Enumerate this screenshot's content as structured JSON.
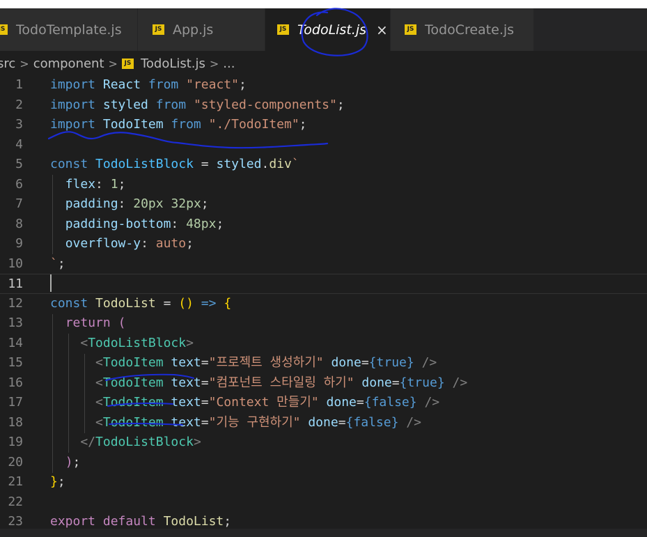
{
  "tabs": [
    {
      "label": "TodoTemplate.js",
      "icon": "JS",
      "active": false
    },
    {
      "label": "App.js",
      "icon": "JS",
      "active": false
    },
    {
      "label": "TodoList.js",
      "icon": "JS",
      "active": true,
      "close": "×"
    },
    {
      "label": "TodoCreate.js",
      "icon": "JS",
      "active": false
    }
  ],
  "breadcrumb": {
    "items": [
      "src",
      "component",
      "TodoList.js",
      "..."
    ],
    "separator": ">",
    "file_icon": "JS"
  },
  "editor": {
    "current_line": 11,
    "lines": [
      {
        "n": 1,
        "tokens": [
          [
            "kw",
            "import"
          ],
          [
            "p",
            " "
          ],
          [
            "var",
            "React"
          ],
          [
            "p",
            " "
          ],
          [
            "kw",
            "from"
          ],
          [
            "p",
            " "
          ],
          [
            "str",
            "\"react\""
          ],
          [
            "p",
            ";"
          ]
        ]
      },
      {
        "n": 2,
        "tokens": [
          [
            "kw",
            "import"
          ],
          [
            "p",
            " "
          ],
          [
            "var",
            "styled"
          ],
          [
            "p",
            " "
          ],
          [
            "kw",
            "from"
          ],
          [
            "p",
            " "
          ],
          [
            "str",
            "\"styled-components\""
          ],
          [
            "p",
            ";"
          ]
        ]
      },
      {
        "n": 3,
        "tokens": [
          [
            "kw",
            "import"
          ],
          [
            "p",
            " "
          ],
          [
            "var",
            "TodoItem"
          ],
          [
            "p",
            " "
          ],
          [
            "kw",
            "from"
          ],
          [
            "p",
            " "
          ],
          [
            "str",
            "\"./TodoItem\""
          ],
          [
            "p",
            ";"
          ]
        ]
      },
      {
        "n": 4,
        "tokens": []
      },
      {
        "n": 5,
        "tokens": [
          [
            "kw",
            "const"
          ],
          [
            "p",
            " "
          ],
          [
            "ent",
            "TodoListBlock"
          ],
          [
            "p",
            " = "
          ],
          [
            "var",
            "styled"
          ],
          [
            "p",
            "."
          ],
          [
            "fn",
            "div"
          ],
          [
            "str",
            "`"
          ]
        ]
      },
      {
        "n": 6,
        "tokens": [
          [
            "p",
            "  "
          ],
          [
            "var",
            "flex"
          ],
          [
            "p",
            ": "
          ],
          [
            "num",
            "1"
          ],
          [
            "p",
            ";"
          ]
        ]
      },
      {
        "n": 7,
        "tokens": [
          [
            "p",
            "  "
          ],
          [
            "var",
            "padding"
          ],
          [
            "p",
            ": "
          ],
          [
            "num",
            "20px"
          ],
          [
            "p",
            " "
          ],
          [
            "num",
            "32px"
          ],
          [
            "p",
            ";"
          ]
        ]
      },
      {
        "n": 8,
        "tokens": [
          [
            "p",
            "  "
          ],
          [
            "var",
            "padding-bottom"
          ],
          [
            "p",
            ": "
          ],
          [
            "num",
            "48px"
          ],
          [
            "p",
            ";"
          ]
        ]
      },
      {
        "n": 9,
        "tokens": [
          [
            "p",
            "  "
          ],
          [
            "var",
            "overflow-y"
          ],
          [
            "p",
            ": "
          ],
          [
            "str",
            "auto"
          ],
          [
            "p",
            ";"
          ]
        ]
      },
      {
        "n": 10,
        "tokens": [
          [
            "str",
            "`"
          ],
          [
            "p",
            ";"
          ]
        ]
      },
      {
        "n": 11,
        "tokens": []
      },
      {
        "n": 12,
        "tokens": [
          [
            "kw",
            "const"
          ],
          [
            "p",
            " "
          ],
          [
            "fn",
            "TodoList"
          ],
          [
            "p",
            " = "
          ],
          [
            "yb",
            "()"
          ],
          [
            "p",
            " "
          ],
          [
            "kw",
            "=>"
          ],
          [
            "p",
            " "
          ],
          [
            "yb",
            "{"
          ]
        ]
      },
      {
        "n": 13,
        "tokens": [
          [
            "p",
            "  "
          ],
          [
            "ctl",
            "return"
          ],
          [
            "p",
            " "
          ],
          [
            "ctl",
            "("
          ]
        ]
      },
      {
        "n": 14,
        "tokens": [
          [
            "p",
            "    "
          ],
          [
            "br",
            "<"
          ],
          [
            "tag",
            "TodoListBlock"
          ],
          [
            "br",
            ">"
          ]
        ]
      },
      {
        "n": 15,
        "tokens": [
          [
            "p",
            "      "
          ],
          [
            "br",
            "<"
          ],
          [
            "tag",
            "TodoItem"
          ],
          [
            "p",
            " "
          ],
          [
            "var",
            "text"
          ],
          [
            "p",
            "="
          ],
          [
            "str",
            "\"프로젝트 생성하기\""
          ],
          [
            "p",
            " "
          ],
          [
            "var",
            "done"
          ],
          [
            "p",
            "="
          ],
          [
            "kw",
            "{"
          ],
          [
            "kw",
            "true"
          ],
          [
            "kw",
            "}"
          ],
          [
            "p",
            " "
          ],
          [
            "br",
            "/>"
          ]
        ]
      },
      {
        "n": 16,
        "tokens": [
          [
            "p",
            "      "
          ],
          [
            "br",
            "<"
          ],
          [
            "tag",
            "TodoItem"
          ],
          [
            "p",
            " "
          ],
          [
            "var",
            "text"
          ],
          [
            "p",
            "="
          ],
          [
            "str",
            "\"컴포넌트 스타일링 하기\""
          ],
          [
            "p",
            " "
          ],
          [
            "var",
            "done"
          ],
          [
            "p",
            "="
          ],
          [
            "kw",
            "{"
          ],
          [
            "kw",
            "true"
          ],
          [
            "kw",
            "}"
          ],
          [
            "p",
            " "
          ],
          [
            "br",
            "/>"
          ]
        ]
      },
      {
        "n": 17,
        "tokens": [
          [
            "p",
            "      "
          ],
          [
            "br",
            "<"
          ],
          [
            "tag",
            "TodoItem"
          ],
          [
            "p",
            " "
          ],
          [
            "var",
            "text"
          ],
          [
            "p",
            "="
          ],
          [
            "str",
            "\"Context 만들기\""
          ],
          [
            "p",
            " "
          ],
          [
            "var",
            "done"
          ],
          [
            "p",
            "="
          ],
          [
            "kw",
            "{"
          ],
          [
            "kw",
            "false"
          ],
          [
            "kw",
            "}"
          ],
          [
            "p",
            " "
          ],
          [
            "br",
            "/>"
          ]
        ]
      },
      {
        "n": 18,
        "tokens": [
          [
            "p",
            "      "
          ],
          [
            "br",
            "<"
          ],
          [
            "tag",
            "TodoItem"
          ],
          [
            "p",
            " "
          ],
          [
            "var",
            "text"
          ],
          [
            "p",
            "="
          ],
          [
            "str",
            "\"기능 구현하기\""
          ],
          [
            "p",
            " "
          ],
          [
            "var",
            "done"
          ],
          [
            "p",
            "="
          ],
          [
            "kw",
            "{"
          ],
          [
            "kw",
            "false"
          ],
          [
            "kw",
            "}"
          ],
          [
            "p",
            " "
          ],
          [
            "br",
            "/>"
          ]
        ]
      },
      {
        "n": 19,
        "tokens": [
          [
            "p",
            "    "
          ],
          [
            "br",
            "</"
          ],
          [
            "tag",
            "TodoListBlock"
          ],
          [
            "br",
            ">"
          ]
        ]
      },
      {
        "n": 20,
        "tokens": [
          [
            "p",
            "  "
          ],
          [
            "ctl",
            ")"
          ],
          [
            "p",
            ";"
          ]
        ]
      },
      {
        "n": 21,
        "tokens": [
          [
            "yb",
            "}"
          ],
          [
            "p",
            ";"
          ]
        ]
      },
      {
        "n": 22,
        "tokens": []
      },
      {
        "n": 23,
        "tokens": [
          [
            "ctl",
            "export"
          ],
          [
            "p",
            " "
          ],
          [
            "ctl",
            "default"
          ],
          [
            "p",
            " "
          ],
          [
            "fn",
            "TodoList"
          ],
          [
            "p",
            ";"
          ]
        ]
      }
    ]
  },
  "colors": {
    "background": "#1e1e1e",
    "tab_inactive": "#2d2d2d",
    "js_icon": "#e8c20b",
    "annotation_ink": "#1a2bd6"
  }
}
